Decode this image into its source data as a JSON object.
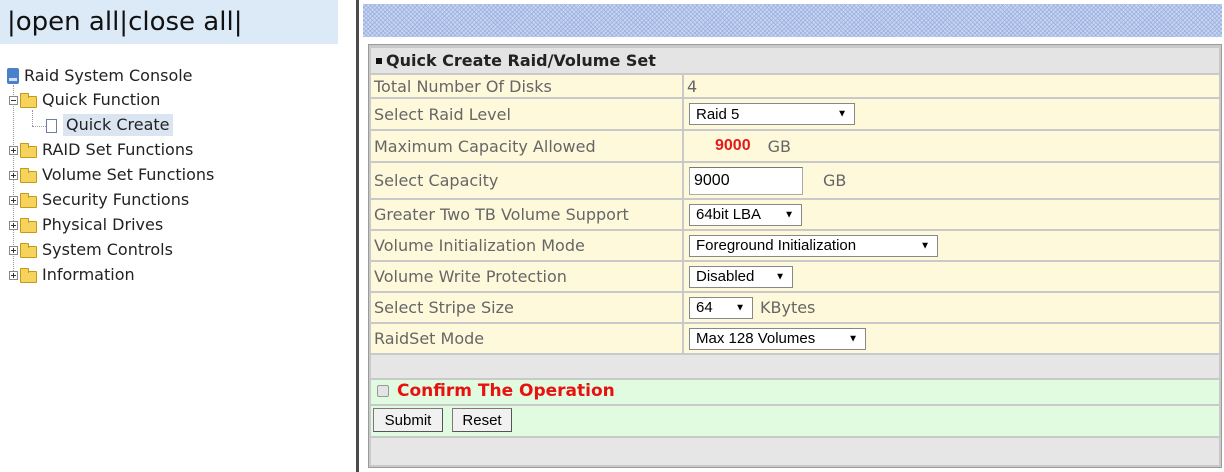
{
  "left_frame": {
    "open_close": {
      "open_all": "open all",
      "close_all": "close all",
      "separator": "|"
    },
    "tree": {
      "root": "Raid System Console",
      "quick_function": "Quick Function",
      "quick_create": "Quick Create",
      "raid_set_functions": "RAID Set Functions",
      "volume_set_functions": "Volume Set Functions",
      "security_functions": "Security Functions",
      "physical_drives": "Physical Drives",
      "system_controls": "System Controls",
      "information": "Information"
    }
  },
  "form": {
    "title": "Quick Create Raid/Volume Set",
    "total_disks": {
      "label": "Total Number Of Disks",
      "value": "4"
    },
    "raid_level": {
      "label": "Select Raid Level",
      "value": "Raid 5"
    },
    "max_capacity": {
      "label": "Maximum Capacity Allowed",
      "value": "9000",
      "unit": "GB"
    },
    "select_capacity": {
      "label": "Select Capacity",
      "value": "9000",
      "unit": "GB"
    },
    "two_tb_support": {
      "label": "Greater Two TB Volume Support",
      "value": "64bit LBA"
    },
    "init_mode": {
      "label": "Volume Initialization Mode",
      "value": "Foreground Initialization"
    },
    "write_protection": {
      "label": "Volume Write Protection",
      "value": "Disabled"
    },
    "stripe_size": {
      "label": "Select Stripe Size",
      "value": "64",
      "unit": "KBytes"
    },
    "raidset_mode": {
      "label": "RaidSet Mode",
      "value": "Max 128 Volumes"
    },
    "confirm_label": "Confirm The Operation",
    "submit_label": "Submit",
    "reset_label": "Reset"
  },
  "colors": {
    "row_bg": "#fff9dc",
    "confirm_bg": "#e1fbe0",
    "confirm_text": "#e81010",
    "max_capacity_value": "#e21b1b",
    "selected_tree_bg": "#dbe4f1"
  },
  "icons": {
    "root": "console-icon",
    "expanded_folder": "minus-box-icon",
    "collapsed_folder": "plus-box-icon",
    "folder": "folder-icon",
    "page": "page-icon"
  }
}
